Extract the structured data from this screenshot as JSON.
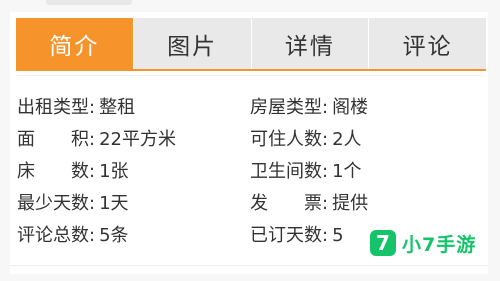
{
  "tabs": [
    {
      "label": "简介",
      "active": true
    },
    {
      "label": "图片",
      "active": false
    },
    {
      "label": "详情",
      "active": false
    },
    {
      "label": "评论",
      "active": false
    }
  ],
  "info": [
    {
      "left_label": "出租类型:",
      "left_value": "整租",
      "right_label": "房屋类型:",
      "right_value": "阁楼"
    },
    {
      "left_label": "面　　积:",
      "left_value": "22平方米",
      "right_label": "可住人数:",
      "right_value": "2人"
    },
    {
      "left_label": "床　　数:",
      "left_value": "1张",
      "right_label": "卫生间数:",
      "right_value": "1个"
    },
    {
      "left_label": "最少天数:",
      "left_value": "1天",
      "right_label": "发　　票:",
      "right_value": "提供"
    },
    {
      "left_label": "评论总数:",
      "left_value": "5条",
      "right_label": "已订天数:",
      "right_value": "5"
    }
  ],
  "watermark": {
    "icon_text": "7",
    "text": "小7手游"
  },
  "colors": {
    "accent": "#f7932b",
    "tab_bg": "#e9e9e9",
    "watermark": "#15c46a"
  }
}
